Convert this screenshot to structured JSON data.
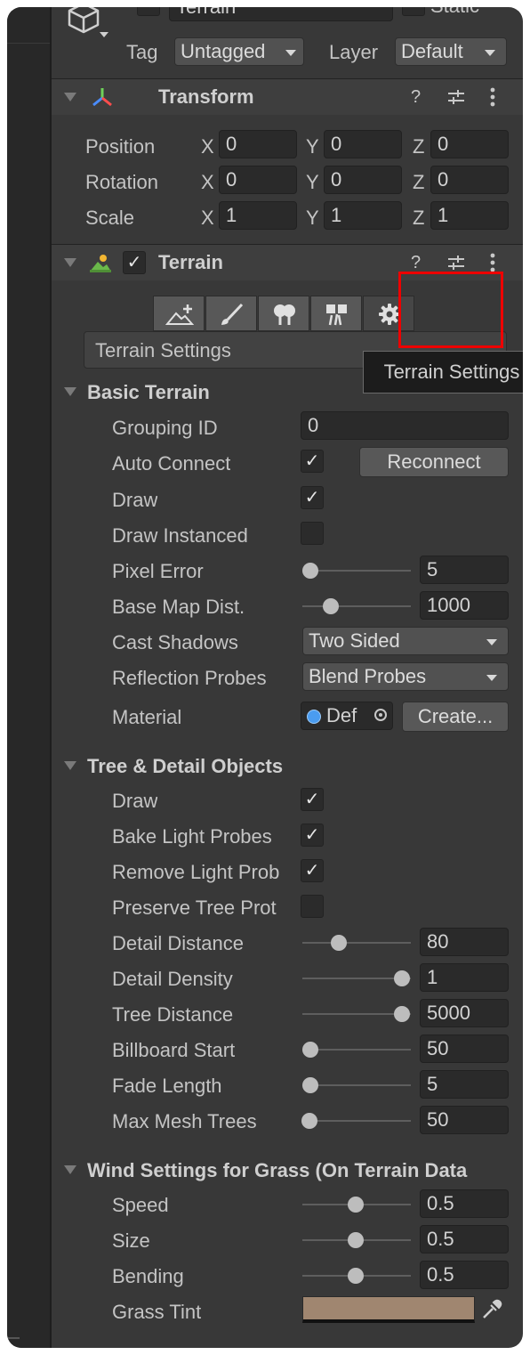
{
  "object_header": {
    "name_value": "Terrain",
    "static_label": "Static",
    "tag_label": "Tag",
    "tag_value": "Untagged",
    "layer_label": "Layer",
    "layer_value": "Default"
  },
  "transform": {
    "title": "Transform",
    "rows": [
      {
        "label": "Position",
        "x": "0",
        "y": "0",
        "z": "0"
      },
      {
        "label": "Rotation",
        "x": "0",
        "y": "0",
        "z": "0"
      },
      {
        "label": "Scale",
        "x": "1",
        "y": "1",
        "z": "1"
      }
    ],
    "axis_labels": {
      "x": "X",
      "y": "Y",
      "z": "Z"
    }
  },
  "terrain": {
    "title": "Terrain",
    "enabled": true,
    "toolbar": [
      "create-neighbor-terrains-icon",
      "paint-terrain-brush-icon",
      "paint-trees-icon",
      "paint-details-icon",
      "terrain-settings-gear-icon"
    ],
    "settings_bar_label": "Terrain Settings",
    "tooltip": "Terrain Settings",
    "highlight_color": "#ee0000"
  },
  "basic_terrain": {
    "title": "Basic Terrain",
    "grouping_id_label": "Grouping ID",
    "grouping_id_value": "0",
    "auto_connect_label": "Auto Connect",
    "reconnect_label": "Reconnect",
    "draw_label": "Draw",
    "draw_instanced_label": "Draw Instanced",
    "pixel_error_label": "Pixel Error",
    "pixel_error_value": "5",
    "base_map_label": "Base Map Dist.",
    "base_map_value": "1000",
    "cast_shadows_label": "Cast Shadows",
    "cast_shadows_value": "Two Sided",
    "reflection_label": "Reflection Probes",
    "reflection_value": "Blend Probes",
    "material_label": "Material",
    "material_value": "Def",
    "create_label": "Create..."
  },
  "tree_detail": {
    "title": "Tree & Detail Objects",
    "draw_label": "Draw",
    "bake_label": "Bake Light Probes",
    "remove_label": "Remove Light Prob",
    "preserve_label": "Preserve Tree Prot",
    "detail_distance_label": "Detail Distance",
    "detail_distance_value": "80",
    "detail_density_label": "Detail Density",
    "detail_density_value": "1",
    "tree_distance_label": "Tree Distance",
    "tree_distance_value": "5000",
    "billboard_label": "Billboard Start",
    "billboard_value": "50",
    "fade_label": "Fade Length",
    "fade_value": "5",
    "max_mesh_label": "Max Mesh Trees",
    "max_mesh_value": "50"
  },
  "wind": {
    "title": "Wind Settings for Grass (On Terrain Data",
    "speed_label": "Speed",
    "speed_value": "0.5",
    "size_label": "Size",
    "size_value": "0.5",
    "bending_label": "Bending",
    "bending_value": "0.5",
    "tint_label": "Grass Tint",
    "tint_color": "#a08670"
  },
  "checkmark": "✓"
}
